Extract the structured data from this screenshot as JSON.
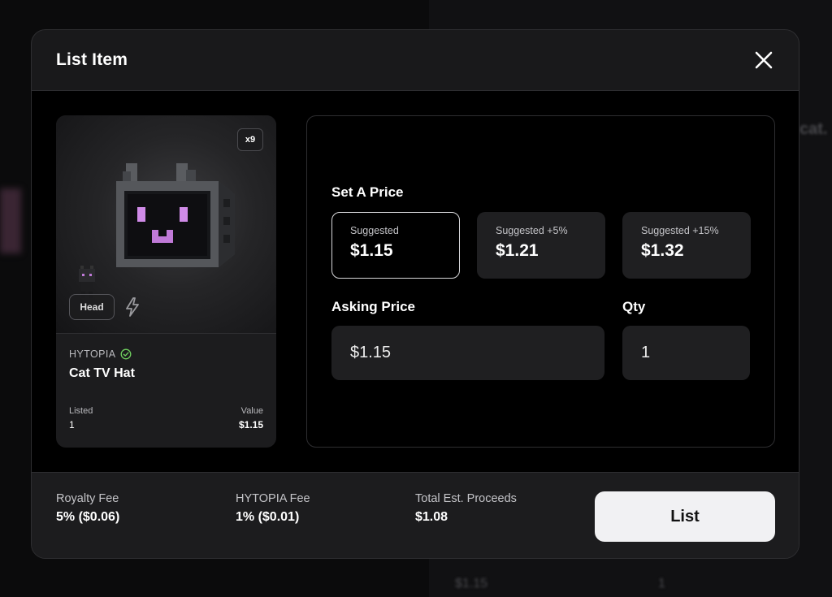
{
  "modal": {
    "title": "List Item",
    "close_icon": "close-icon"
  },
  "item": {
    "quantity_badge": "x9",
    "slot": "Head",
    "brand": "HYTOPIA",
    "name": "Cat TV Hat",
    "listed_label": "Listed",
    "listed_value": "1",
    "value_label": "Value",
    "value_value": "$1.15",
    "verified_icon": "verified-check-icon",
    "boost_icon": "lightning-bolt-icon"
  },
  "pricing": {
    "section_title": "Set A Price",
    "suggestions": [
      {
        "label": "Suggested",
        "price": "$1.15",
        "selected": true
      },
      {
        "label": "Suggested +5%",
        "price": "$1.21",
        "selected": false
      },
      {
        "label": "Suggested +15%",
        "price": "$1.32",
        "selected": false
      }
    ],
    "asking_label": "Asking Price",
    "asking_value": "$1.15",
    "qty_label": "Qty",
    "qty_value": "1"
  },
  "footer": {
    "royalty_label": "Royalty Fee",
    "royalty_value": "5% ($0.06)",
    "platform_fee_label": "HYTOPIA Fee",
    "platform_fee_value": "1% ($0.01)",
    "proceeds_label": "Total Est. Proceeds",
    "proceeds_value": "$1.08",
    "list_button": "List"
  },
  "background": {
    "fragment_1": "cat.",
    "fragment_2": "$1.15",
    "fragment_3": "1"
  }
}
